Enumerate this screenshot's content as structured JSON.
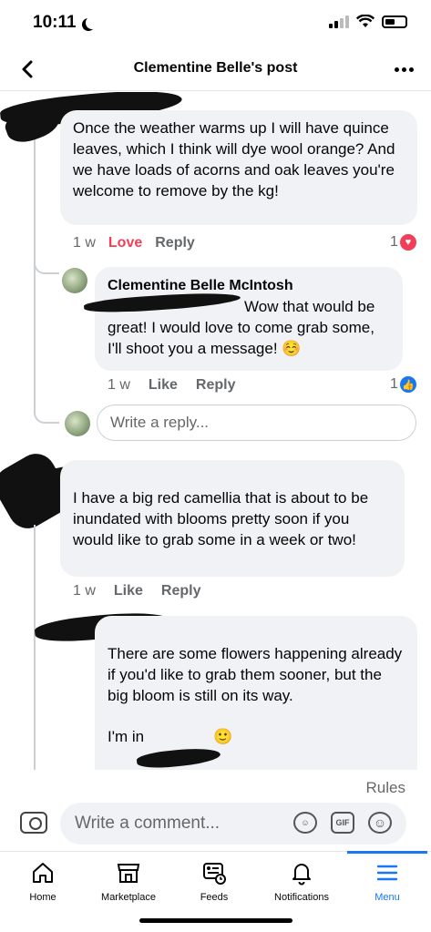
{
  "status": {
    "time": "10:11"
  },
  "header": {
    "title": "Clementine Belle's post"
  },
  "comments": [
    {
      "text": "Once the weather warms up I will have quince leaves, which I think will dye wool orange? And we have loads of acorns and oak leaves you're welcome to remove by the kg!",
      "time": "1 w",
      "reaction_label": "Love",
      "reply_label": "Reply",
      "reaction_count": "1"
    },
    {
      "author": "Clementine Belle McIntosh",
      "text": "Wow that would be great! I would love to come grab some, I'll shoot you a message! ☺️",
      "time": "1 w",
      "reaction_label": "Like",
      "reply_label": "Reply",
      "reaction_count": "1"
    },
    {
      "text": "I have a big red camellia that is about to be inundated with blooms pretty soon if you would like to grab some in a week or two!",
      "time": "1 w",
      "reaction_label": "Like",
      "reply_label": "Reply"
    },
    {
      "text": "There are some flowers happening already if you'd like to grab them sooner, but the big bloom is still on its way.",
      "text2": "I'm in",
      "emoji": "🙂"
    }
  ],
  "reply_box": {
    "placeholder": "Write a reply..."
  },
  "rules": "Rules",
  "composer": {
    "placeholder": "Write a comment...",
    "gif": "GIF"
  },
  "tabs": [
    {
      "label": "Home"
    },
    {
      "label": "Marketplace"
    },
    {
      "label": "Feeds"
    },
    {
      "label": "Notifications"
    },
    {
      "label": "Menu"
    }
  ],
  "colors": {
    "love": "#f33e58",
    "like": "#1877f2",
    "accent": "#1877f2"
  }
}
